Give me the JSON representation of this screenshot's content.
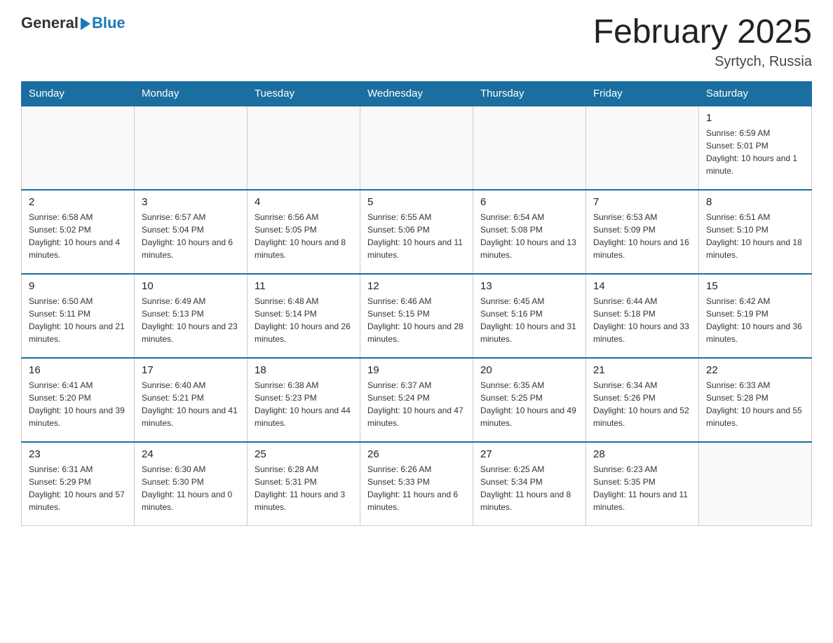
{
  "logo": {
    "general": "General",
    "blue": "Blue"
  },
  "title": "February 2025",
  "subtitle": "Syrtych, Russia",
  "days_of_week": [
    "Sunday",
    "Monday",
    "Tuesday",
    "Wednesday",
    "Thursday",
    "Friday",
    "Saturday"
  ],
  "weeks": [
    [
      {
        "day": "",
        "info": ""
      },
      {
        "day": "",
        "info": ""
      },
      {
        "day": "",
        "info": ""
      },
      {
        "day": "",
        "info": ""
      },
      {
        "day": "",
        "info": ""
      },
      {
        "day": "",
        "info": ""
      },
      {
        "day": "1",
        "info": "Sunrise: 6:59 AM\nSunset: 5:01 PM\nDaylight: 10 hours and 1 minute."
      }
    ],
    [
      {
        "day": "2",
        "info": "Sunrise: 6:58 AM\nSunset: 5:02 PM\nDaylight: 10 hours and 4 minutes."
      },
      {
        "day": "3",
        "info": "Sunrise: 6:57 AM\nSunset: 5:04 PM\nDaylight: 10 hours and 6 minutes."
      },
      {
        "day": "4",
        "info": "Sunrise: 6:56 AM\nSunset: 5:05 PM\nDaylight: 10 hours and 8 minutes."
      },
      {
        "day": "5",
        "info": "Sunrise: 6:55 AM\nSunset: 5:06 PM\nDaylight: 10 hours and 11 minutes."
      },
      {
        "day": "6",
        "info": "Sunrise: 6:54 AM\nSunset: 5:08 PM\nDaylight: 10 hours and 13 minutes."
      },
      {
        "day": "7",
        "info": "Sunrise: 6:53 AM\nSunset: 5:09 PM\nDaylight: 10 hours and 16 minutes."
      },
      {
        "day": "8",
        "info": "Sunrise: 6:51 AM\nSunset: 5:10 PM\nDaylight: 10 hours and 18 minutes."
      }
    ],
    [
      {
        "day": "9",
        "info": "Sunrise: 6:50 AM\nSunset: 5:11 PM\nDaylight: 10 hours and 21 minutes."
      },
      {
        "day": "10",
        "info": "Sunrise: 6:49 AM\nSunset: 5:13 PM\nDaylight: 10 hours and 23 minutes."
      },
      {
        "day": "11",
        "info": "Sunrise: 6:48 AM\nSunset: 5:14 PM\nDaylight: 10 hours and 26 minutes."
      },
      {
        "day": "12",
        "info": "Sunrise: 6:46 AM\nSunset: 5:15 PM\nDaylight: 10 hours and 28 minutes."
      },
      {
        "day": "13",
        "info": "Sunrise: 6:45 AM\nSunset: 5:16 PM\nDaylight: 10 hours and 31 minutes."
      },
      {
        "day": "14",
        "info": "Sunrise: 6:44 AM\nSunset: 5:18 PM\nDaylight: 10 hours and 33 minutes."
      },
      {
        "day": "15",
        "info": "Sunrise: 6:42 AM\nSunset: 5:19 PM\nDaylight: 10 hours and 36 minutes."
      }
    ],
    [
      {
        "day": "16",
        "info": "Sunrise: 6:41 AM\nSunset: 5:20 PM\nDaylight: 10 hours and 39 minutes."
      },
      {
        "day": "17",
        "info": "Sunrise: 6:40 AM\nSunset: 5:21 PM\nDaylight: 10 hours and 41 minutes."
      },
      {
        "day": "18",
        "info": "Sunrise: 6:38 AM\nSunset: 5:23 PM\nDaylight: 10 hours and 44 minutes."
      },
      {
        "day": "19",
        "info": "Sunrise: 6:37 AM\nSunset: 5:24 PM\nDaylight: 10 hours and 47 minutes."
      },
      {
        "day": "20",
        "info": "Sunrise: 6:35 AM\nSunset: 5:25 PM\nDaylight: 10 hours and 49 minutes."
      },
      {
        "day": "21",
        "info": "Sunrise: 6:34 AM\nSunset: 5:26 PM\nDaylight: 10 hours and 52 minutes."
      },
      {
        "day": "22",
        "info": "Sunrise: 6:33 AM\nSunset: 5:28 PM\nDaylight: 10 hours and 55 minutes."
      }
    ],
    [
      {
        "day": "23",
        "info": "Sunrise: 6:31 AM\nSunset: 5:29 PM\nDaylight: 10 hours and 57 minutes."
      },
      {
        "day": "24",
        "info": "Sunrise: 6:30 AM\nSunset: 5:30 PM\nDaylight: 11 hours and 0 minutes."
      },
      {
        "day": "25",
        "info": "Sunrise: 6:28 AM\nSunset: 5:31 PM\nDaylight: 11 hours and 3 minutes."
      },
      {
        "day": "26",
        "info": "Sunrise: 6:26 AM\nSunset: 5:33 PM\nDaylight: 11 hours and 6 minutes."
      },
      {
        "day": "27",
        "info": "Sunrise: 6:25 AM\nSunset: 5:34 PM\nDaylight: 11 hours and 8 minutes."
      },
      {
        "day": "28",
        "info": "Sunrise: 6:23 AM\nSunset: 5:35 PM\nDaylight: 11 hours and 11 minutes."
      },
      {
        "day": "",
        "info": ""
      }
    ]
  ]
}
